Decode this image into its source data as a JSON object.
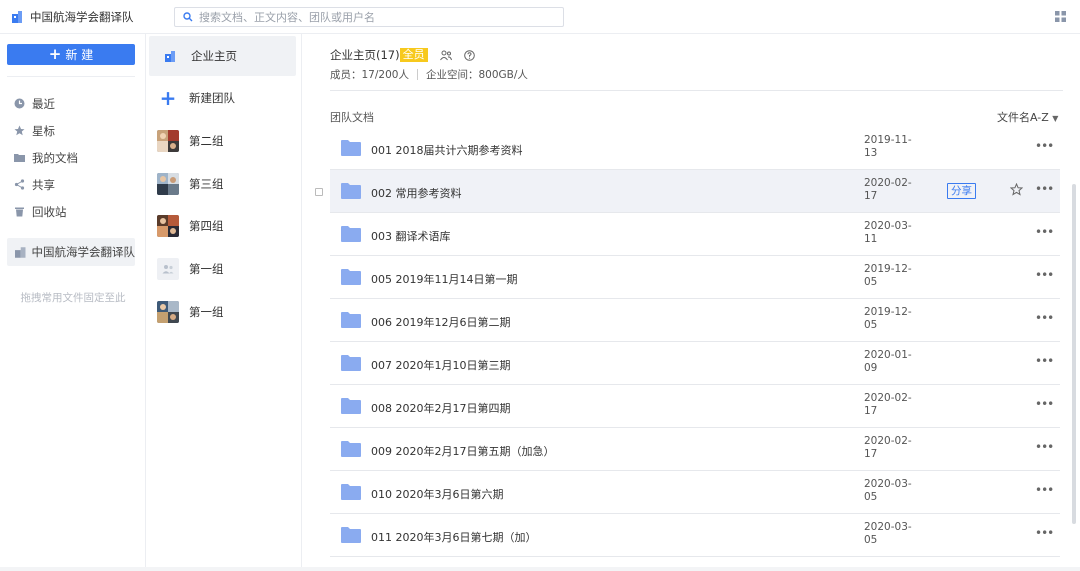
{
  "topbar": {
    "brand": "中国航海学会翻译队",
    "search_placeholder": "搜索文档、正文内容、团队或用户名"
  },
  "sidebar": {
    "new_label": "新 建",
    "items": [
      {
        "label": "最近",
        "icon": "clock-icon"
      },
      {
        "label": "星标",
        "icon": "star-icon"
      },
      {
        "label": "我的文档",
        "icon": "folder-icon"
      },
      {
        "label": "共享",
        "icon": "share-icon"
      },
      {
        "label": "回收站",
        "icon": "trash-icon"
      }
    ],
    "team_label": "中国航海学会翻译队",
    "drag_hint": "拖拽常用文件固定至此"
  },
  "teams": [
    {
      "label": "企业主页",
      "type": "home"
    },
    {
      "label": "新建团队",
      "type": "plus"
    },
    {
      "label": "第二组",
      "type": "photo"
    },
    {
      "label": "第三组",
      "type": "photo"
    },
    {
      "label": "第四组",
      "type": "photo"
    },
    {
      "label": "第一组",
      "type": "generic"
    },
    {
      "label": "第一组",
      "type": "photo"
    }
  ],
  "main": {
    "enterprise_title": "企业主页(17)",
    "badge": "全员",
    "members": "成员：17/200人",
    "space": "企业空间：800GB/人",
    "section_title": "团队文档",
    "sort_label": "文件名A-Z",
    "share_label": "分享"
  },
  "files": [
    {
      "name": "001 2018届共计六期参考资料",
      "date_line1": "2019-11-",
      "date_line2": "13"
    },
    {
      "name": "002 常用参考资料",
      "date_line1": "2020-02-",
      "date_line2": "17"
    },
    {
      "name": "003 翻译术语库",
      "date_line1": "2020-03-",
      "date_line2": "11"
    },
    {
      "name": "005 2019年11月14日第一期",
      "date_line1": "2019-12-",
      "date_line2": "05"
    },
    {
      "name": "006 2019年12月6日第二期",
      "date_line1": "2019-12-",
      "date_line2": "05"
    },
    {
      "name": "007 2020年1月10日第三期",
      "date_line1": "2020-01-",
      "date_line2": "09"
    },
    {
      "name": "008 2020年2月17日第四期",
      "date_line1": "2020-02-",
      "date_line2": "17"
    },
    {
      "name": "009 2020年2月17日第五期（加急）",
      "date_line1": "2020-02-",
      "date_line2": "17"
    },
    {
      "name": "010 2020年3月6日第六期",
      "date_line1": "2020-03-",
      "date_line2": "05"
    },
    {
      "name": "011 2020年3月6日第七期（加）",
      "date_line1": "2020-03-",
      "date_line2": "05"
    }
  ],
  "colors": {
    "accent": "#3a7bf0",
    "folder": "#8aabf0",
    "badge": "#f7c91d",
    "hover_row": "#f0f2f7"
  }
}
